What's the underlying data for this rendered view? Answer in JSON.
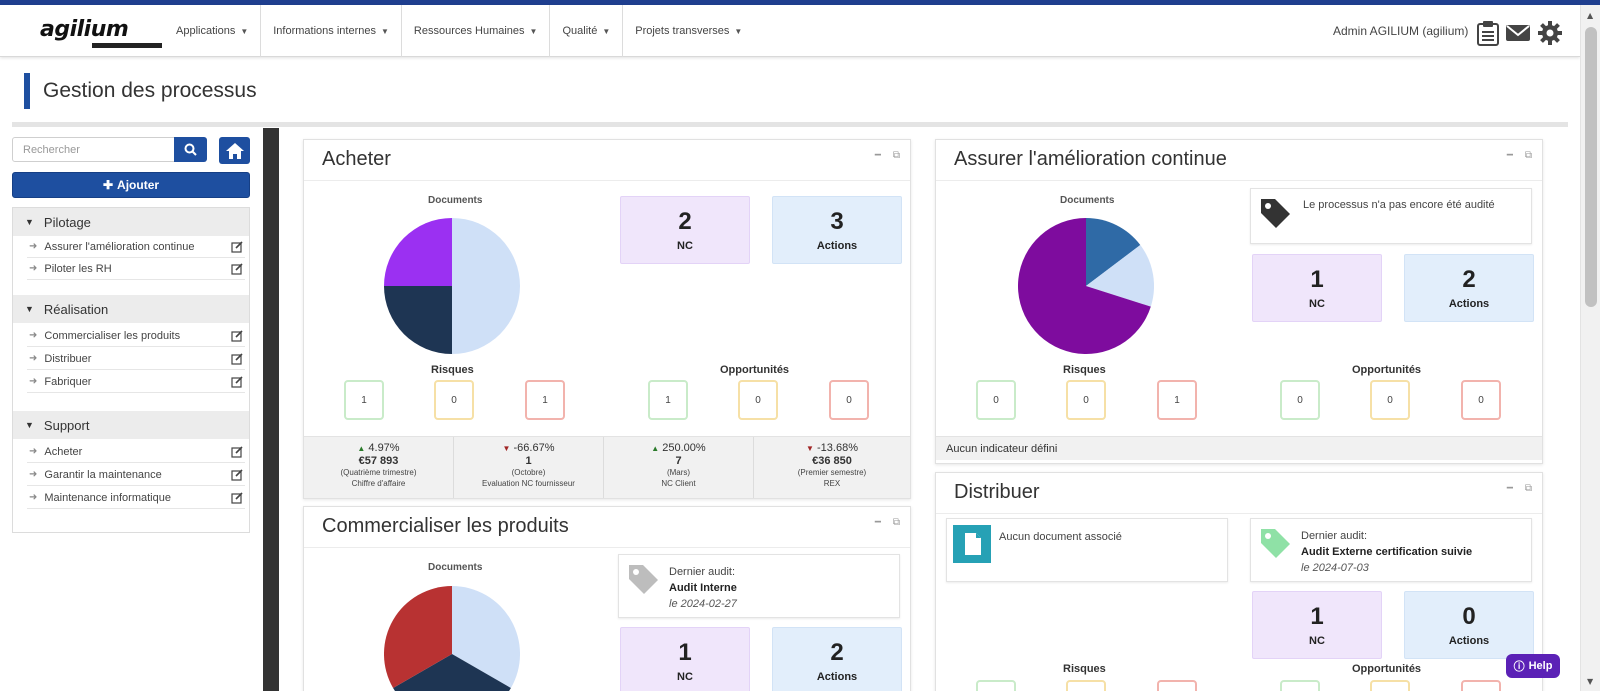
{
  "app": {
    "logo": "agilium",
    "user": "Admin AGILIUM (agilium)"
  },
  "nav": {
    "items": [
      {
        "label": "Applications"
      },
      {
        "label": "Informations internes"
      },
      {
        "label": "Ressources Humaines"
      },
      {
        "label": "Qualité"
      },
      {
        "label": "Projets transverses"
      }
    ]
  },
  "icons": {
    "tasks": "clipboard-icon",
    "mail": "envelope-icon",
    "settings": "gear-icon"
  },
  "page": {
    "title": "Gestion des processus"
  },
  "sidebar": {
    "search_placeholder": "Rechercher",
    "add_label": "Ajouter",
    "groups": [
      {
        "label": "Pilotage",
        "items": [
          "Assurer l'amélioration continue",
          "Piloter les RH"
        ]
      },
      {
        "label": "Réalisation",
        "items": [
          "Commercialiser les produits",
          "Distribuer",
          "Fabriquer"
        ]
      },
      {
        "label": "Support",
        "items": [
          "Acheter",
          "Garantir la maintenance",
          "Maintenance informatique"
        ]
      }
    ]
  },
  "labels": {
    "documents": "Documents",
    "risques": "Risques",
    "opportunites": "Opportunités",
    "nc": "NC",
    "actions": "Actions",
    "no_indicator": "Aucun indicateur défini",
    "not_audited": "Le processus n'a pas encore été audité",
    "no_document": "Aucun document associé",
    "last_audit": "Dernier audit:"
  },
  "colors": {
    "primary": "#1e4fa0",
    "pie_purple": "#9b30f2",
    "pie_navy": "#1e3553",
    "pie_light": "#cfe0f7",
    "pie_red": "#b83232",
    "pie_violet": "#7e0c9e",
    "pie_steel": "#2f6aa6",
    "help": "#5b21b6"
  },
  "panels": {
    "acheter": {
      "title": "Acheter",
      "nc": "2",
      "actions": "3",
      "risques": [
        "1",
        "0",
        "1"
      ],
      "opportunites": [
        "1",
        "0",
        "0"
      ],
      "kpis": [
        {
          "pct": "4.97%",
          "dir": "up",
          "value": "€57 893",
          "period": "(Quatrième trimestre)",
          "name": "Chiffre d'affaire"
        },
        {
          "pct": "-66.67%",
          "dir": "down",
          "value": "1",
          "period": "(Octobre)",
          "name": "Evaluation NC fournisseur"
        },
        {
          "pct": "250.00%",
          "dir": "up",
          "value": "7",
          "period": "(Mars)",
          "name": "NC Client"
        },
        {
          "pct": "-13.68%",
          "dir": "down",
          "value": "€36 850",
          "period": "(Premier semestre)",
          "name": "REX"
        }
      ]
    },
    "amelioration": {
      "title": "Assurer l'amélioration continue",
      "nc": "1",
      "actions": "2",
      "risques": [
        "0",
        "0",
        "1"
      ],
      "opportunites": [
        "0",
        "0",
        "0"
      ]
    },
    "commercialiser": {
      "title": "Commercialiser les produits",
      "audit_name": "Audit Interne",
      "audit_date": "le 2024-02-27",
      "nc": "1",
      "actions": "2"
    },
    "distribuer": {
      "title": "Distribuer",
      "audit_name": "Audit Externe certification suivie",
      "audit_date": "le 2024-07-03",
      "nc": "1",
      "actions": "0"
    }
  },
  "chart_data": [
    {
      "type": "pie",
      "title": "Documents",
      "slice_shares": [
        0.5,
        0.25,
        0.25
      ],
      "colors": [
        "#cfe0f7",
        "#1e3553",
        "#9b30f2"
      ]
    },
    {
      "type": "pie",
      "title": "Documents",
      "slice_shares": [
        0.15,
        0.15,
        0.7
      ],
      "colors": [
        "#2f6aa6",
        "#cfe0f7",
        "#7e0c9e"
      ]
    },
    {
      "type": "pie",
      "title": "Documents",
      "slice_shares": [
        0.333,
        0.333,
        0.334
      ],
      "colors": [
        "#cfe0f7",
        "#1e3553",
        "#b83232"
      ]
    }
  ],
  "help": {
    "label": "Help"
  }
}
